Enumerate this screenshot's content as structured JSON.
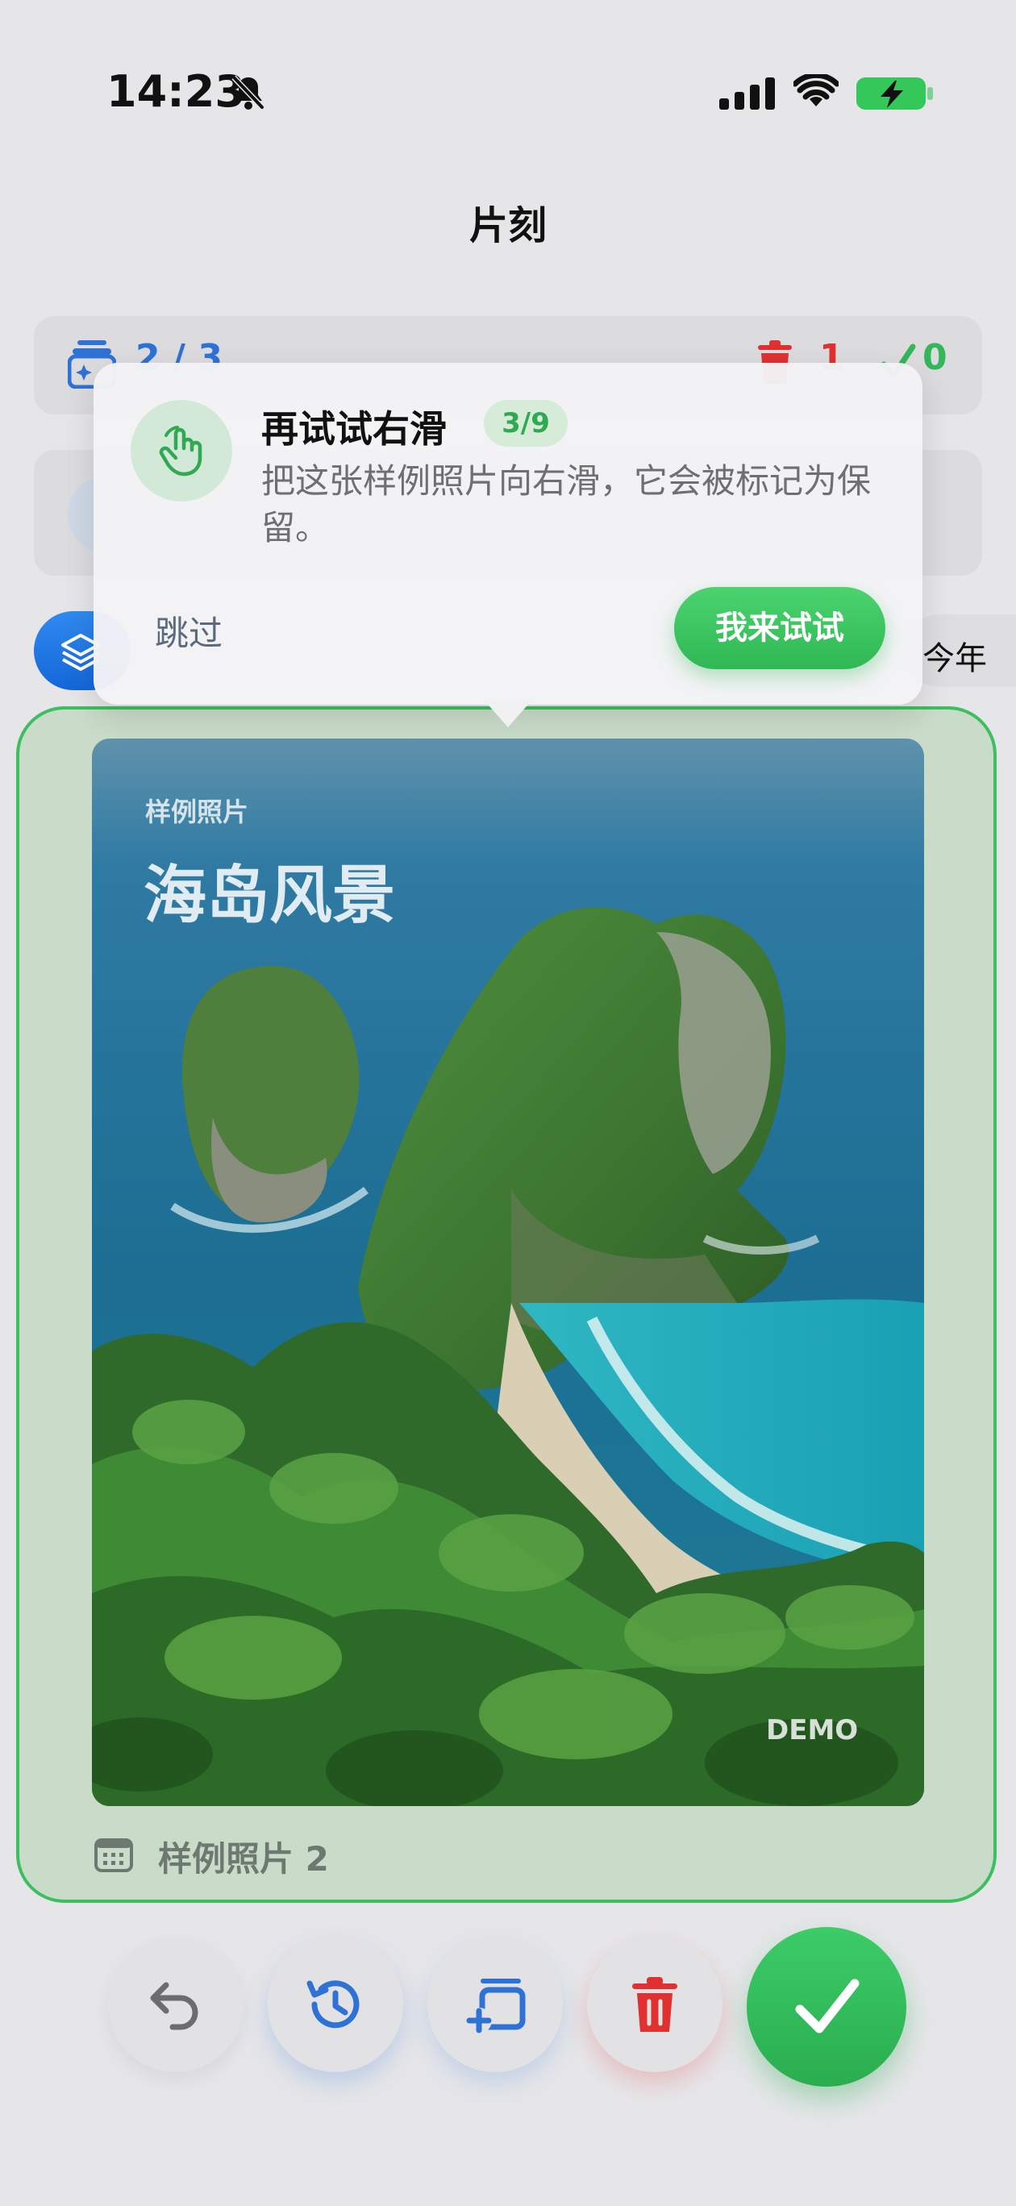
{
  "status_bar": {
    "time": "14:23",
    "icons": [
      "bell-slash-icon",
      "cellular-signal-icon",
      "wifi-icon",
      "battery-charging-icon"
    ],
    "battery_color": "#34c759"
  },
  "header": {
    "title": "片刻"
  },
  "summary": {
    "count_text": "2 / 3",
    "delete_count": "1",
    "keep_count": "0"
  },
  "filters": {
    "year_chip": "今年"
  },
  "tooltip": {
    "title": "再试试右滑",
    "step_badge": "3/9",
    "description": "把这张样例照片向右滑，它会被标记为保留。",
    "skip_label": "跳过",
    "cta_label": "我来试试",
    "icon": "hand-swipe-icon"
  },
  "card": {
    "kicker": "样例照片",
    "title": "海岛风景",
    "watermark": "DEMO",
    "caption": "样例照片 2",
    "border_color": "#3cbf5f"
  },
  "actions": [
    {
      "name": "undo",
      "icon": "undo-arrow-icon"
    },
    {
      "name": "history",
      "icon": "history-clock-icon"
    },
    {
      "name": "add-to-album",
      "icon": "add-album-icon"
    },
    {
      "name": "delete",
      "icon": "trash-icon"
    },
    {
      "name": "keep",
      "icon": "checkmark-icon"
    }
  ],
  "colors": {
    "accent_blue": "#2f72d6",
    "delete_red": "#e03030",
    "keep_green": "#34b65a"
  }
}
